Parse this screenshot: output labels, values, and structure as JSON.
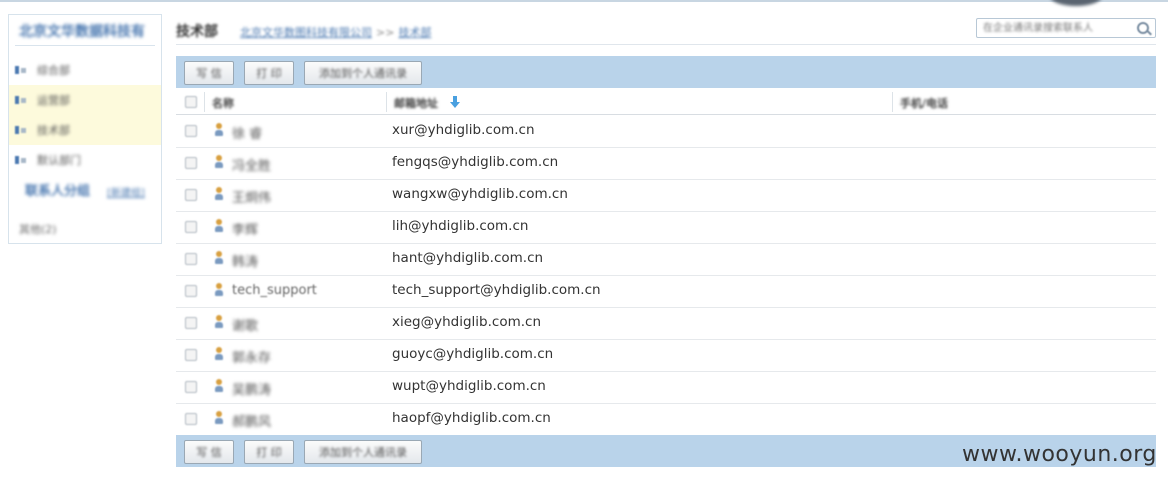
{
  "sidebar": {
    "org_title": "北京文华数据科技有",
    "departments": [
      {
        "label": "综合部",
        "highlighted": false
      },
      {
        "label": "运营部",
        "highlighted": true
      },
      {
        "label": "技术部",
        "highlighted": true
      },
      {
        "label": "默认部门",
        "highlighted": false
      }
    ],
    "contact_groups_title": "联系人分组",
    "new_group_label": "[新建组]",
    "other_group_label": "其他(2)"
  },
  "header": {
    "title": "技术部",
    "breadcrumb_root": "北京文华数图科技有限公司",
    "breadcrumb_sep": ">>",
    "breadcrumb_current": "技术部",
    "search_placeholder": "在企业通讯录搜索联系人"
  },
  "toolbar": {
    "write_label": "写 信",
    "print_label": "打 印",
    "add_personal_label": "添加到个人通讯录"
  },
  "table": {
    "col_name": "名称",
    "col_email": "邮箱地址",
    "col_phone": "手机/电话",
    "rows": [
      {
        "name": "徐 睿",
        "email": "xur@yhdiglib.com.cn"
      },
      {
        "name": "冯全胜",
        "email": "fengqs@yhdiglib.com.cn"
      },
      {
        "name": "王炯伟",
        "email": "wangxw@yhdiglib.com.cn"
      },
      {
        "name": "李辉",
        "email": "lih@yhdiglib.com.cn"
      },
      {
        "name": "韩涛",
        "email": "hant@yhdiglib.com.cn"
      },
      {
        "name": "tech_support",
        "email": "tech_support@yhdiglib.com.cn"
      },
      {
        "name": "谢歌",
        "email": "xieg@yhdiglib.com.cn"
      },
      {
        "name": "郭永存",
        "email": "guoyc@yhdiglib.com.cn"
      },
      {
        "name": "吴鹏涛",
        "email": "wupt@yhdiglib.com.cn"
      },
      {
        "name": "郝鹏风",
        "email": "haopf@yhdiglib.com.cn"
      }
    ]
  },
  "watermark": "www.wooyun.org",
  "colors": {
    "toolbar_bg": "#b9d3ea",
    "highlight_bg": "#fdfadc",
    "link_blue": "#4a78b0"
  }
}
